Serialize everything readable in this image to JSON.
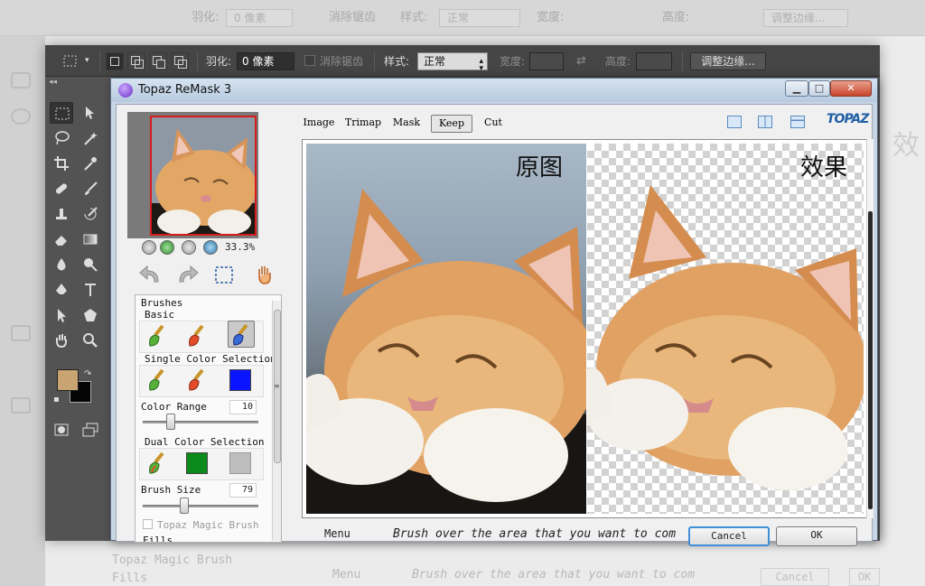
{
  "options_bar": {
    "feather_label": "羽化:",
    "feather_value": "0 像素",
    "antialias_label": "消除锯齿",
    "style_label": "样式:",
    "style_value": "正常",
    "width_label": "宽度:",
    "height_label": "高度:",
    "refine_edge_button": "调整边缘..."
  },
  "dialog": {
    "title": "Topaz ReMask 3",
    "min_glyph": "▁",
    "max_glyph": "□",
    "close_glyph": "✕"
  },
  "navigator": {
    "zoom": "33.3%"
  },
  "tabs": [
    {
      "label": "Image",
      "active": false
    },
    {
      "label": "Trimap",
      "active": false
    },
    {
      "label": "Mask",
      "active": false
    },
    {
      "label": "Keep",
      "active": true
    },
    {
      "label": "Cut",
      "active": false
    }
  ],
  "brand": "TOPAZ",
  "panel": {
    "brushes_header": "Brushes",
    "basic_label": "Basic",
    "single_color_label": "Single Color Selection",
    "single_color": "#0a14ff",
    "color_range_label": "Color Range",
    "color_range_value": "10",
    "color_range_level": 0.22,
    "dual_color_label": "Dual Color Selection",
    "dual_color_a": "#0a8a1a",
    "dual_color_b": "#bdbdbd",
    "brush_size_label": "Brush Size",
    "brush_size_value": "79",
    "brush_size_level": 0.35,
    "magic_brush_label": "Topaz Magic Brush",
    "fills_label": "Fills"
  },
  "canvas": {
    "original_label": "原图",
    "result_label": "效果"
  },
  "statusbar": {
    "menu_label": "Menu",
    "message": "Brush over the area that you want to com",
    "cancel_label": "Cancel",
    "ok_label": "OK"
  },
  "colors": {
    "foreground": "#c9a473",
    "background": "#050505",
    "selection_border": "#d41c1c"
  },
  "background_ghost": {
    "feather_label": "羽化:",
    "feather_value": "0 像素",
    "antialias_label": "消除锯齿",
    "style_label": "样式:",
    "style_value": "正常",
    "width_label": "宽度:",
    "height_label": "高度:",
    "refine_edge_button": "调整边缘...",
    "right_text": "效",
    "magic_brush_label": "Topaz Magic Brush",
    "fills_label": "Fills",
    "menu_label": "Menu",
    "message": "Brush over the area that you want to com",
    "cancel_label": "Cancel",
    "ok_label": "OK"
  }
}
